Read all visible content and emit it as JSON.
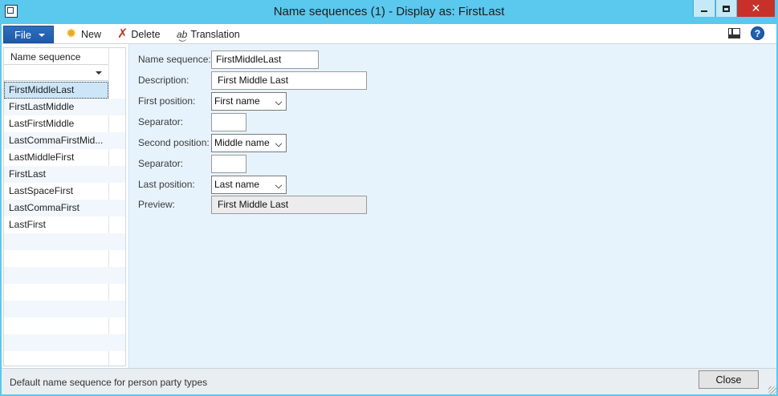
{
  "window": {
    "title": "Name sequences (1) - Display as: FirstLast"
  },
  "actionpane": {
    "file_label": "File",
    "new_label": "New",
    "delete_label": "Delete",
    "translation_label": "Translation"
  },
  "grid": {
    "header": "Name sequence",
    "rows": [
      "FirstMiddleLast",
      "FirstLastMiddle",
      "LastFirstMiddle",
      "LastCommaFirstMid...",
      "LastMiddleFirst",
      "FirstLast",
      "LastSpaceFirst",
      "LastCommaFirst",
      "LastFirst"
    ],
    "selected_index": 0
  },
  "form": {
    "name_sequence_label": "Name sequence:",
    "name_sequence_value": "FirstMiddleLast",
    "description_label": "Description:",
    "description_value": "First Middle Last",
    "first_position_label": "First position:",
    "first_position_value": "First name",
    "separator1_label": "Separator:",
    "separator1_value": "",
    "second_position_label": "Second position:",
    "second_position_value": "Middle name",
    "separator2_label": "Separator:",
    "separator2_value": "",
    "last_position_label": "Last position:",
    "last_position_value": "Last name",
    "preview_label": "Preview:",
    "preview_value": "First Middle Last"
  },
  "statusbar": {
    "text": "Default name sequence for person party types",
    "close_label": "Close"
  },
  "icons": {
    "app": "app-icon",
    "new": "sun-icon",
    "delete": "x-icon",
    "translation": "translation-icon",
    "layout": "layout-icon",
    "help": "help-icon"
  },
  "colors": {
    "titlebar": "#5bc8ee",
    "file_button": "#1e5aa8",
    "close_window": "#c7312a",
    "form_bg": "#e7f3fc",
    "selection": "#cde6f7"
  }
}
